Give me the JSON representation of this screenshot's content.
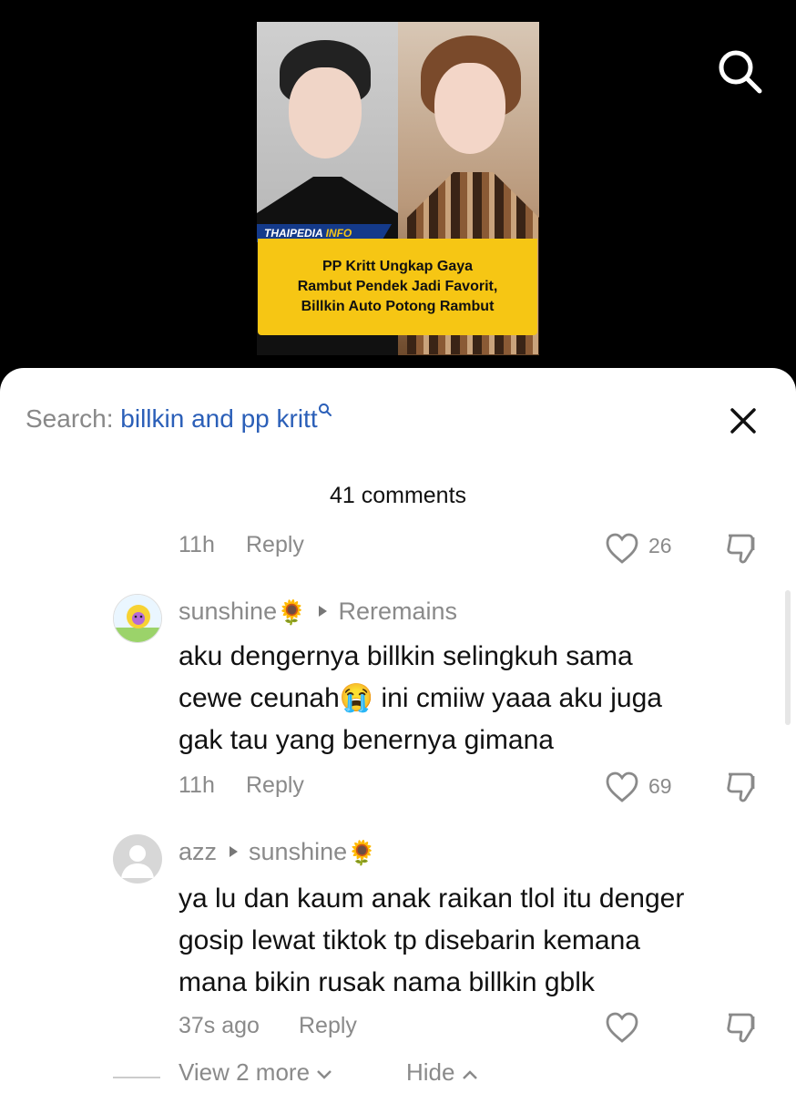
{
  "thumbnail": {
    "brand_prefix": "THAIPEDIA",
    "brand_suffix": "INFO",
    "headline_line1": "PP Kritt Ungkap Gaya",
    "headline_line2": "Rambut Pendek Jadi Favorit,",
    "headline_line3": "Billkin Auto Potong Rambut"
  },
  "header": {
    "search_prefix": "Search:",
    "search_query": "billkin and pp kritt",
    "comment_count": "41 comments"
  },
  "comments": [
    {
      "time": "11h",
      "reply_label": "Reply",
      "likes": "26"
    },
    {
      "author": "sunshine",
      "author_emoji": "🌻",
      "reply_to": "Reremains",
      "text_line1": "aku dengernya billkin selingkuh sama",
      "text_line2a": "cewe ceunah",
      "text_line2_emoji": "😭",
      "text_line2b": " ini cmiiw yaaa aku juga",
      "text_line3": "gak tau yang benernya gimana",
      "time": "11h",
      "reply_label": "Reply",
      "likes": "69"
    },
    {
      "author": "azz",
      "reply_to": "sunshine",
      "reply_to_emoji": "🌻",
      "text_line1": "ya lu dan kaum anak raikan tlol itu denger",
      "text_line2": "gosip lewat tiktok tp disebarin kemana",
      "text_line3": "mana bikin rusak nama billkin gblk",
      "time": "37s ago",
      "reply_label": "Reply"
    }
  ],
  "footer": {
    "view_more": "View 2 more",
    "hide": "Hide"
  },
  "icons": {
    "search": "search-icon",
    "close": "close-icon",
    "heart": "heart-icon",
    "dislike": "thumb-down-icon"
  },
  "colors": {
    "link_blue": "#2b5fb8",
    "muted": "#8a8a8a",
    "banner_yellow": "#f6c614"
  }
}
